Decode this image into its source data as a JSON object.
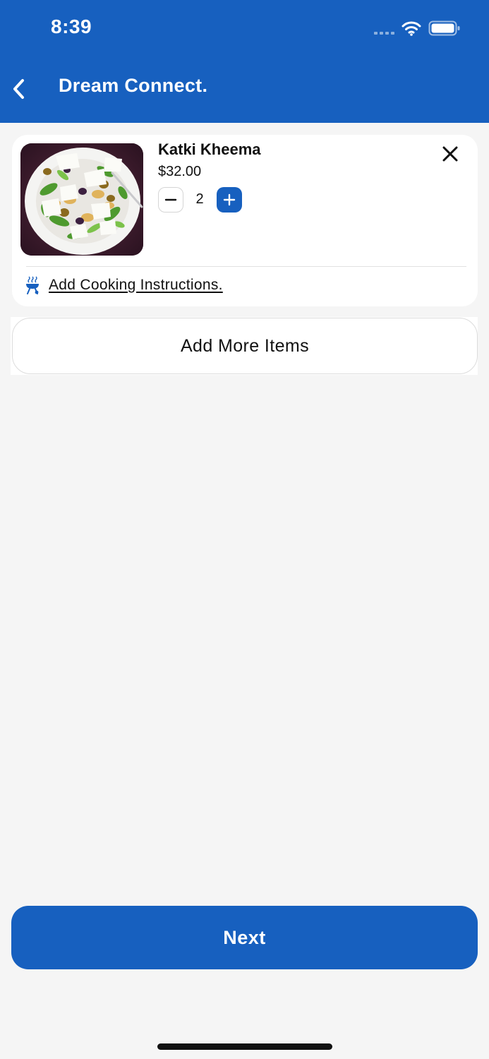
{
  "status_bar": {
    "time": "8:39"
  },
  "header": {
    "title": "Dream Connect.",
    "back_icon": "chevron-left-icon"
  },
  "cart": {
    "item": {
      "name": "Katki Kheema",
      "price": "$32.00",
      "quantity": "2",
      "image_icon": "food-photo"
    },
    "cooking_instructions_label": "Add Cooking Instructions."
  },
  "add_more_label": "Add More Items",
  "next_label": "Next",
  "colors": {
    "primary": "#1760bf",
    "background": "#f5f5f5",
    "card": "#ffffff"
  }
}
